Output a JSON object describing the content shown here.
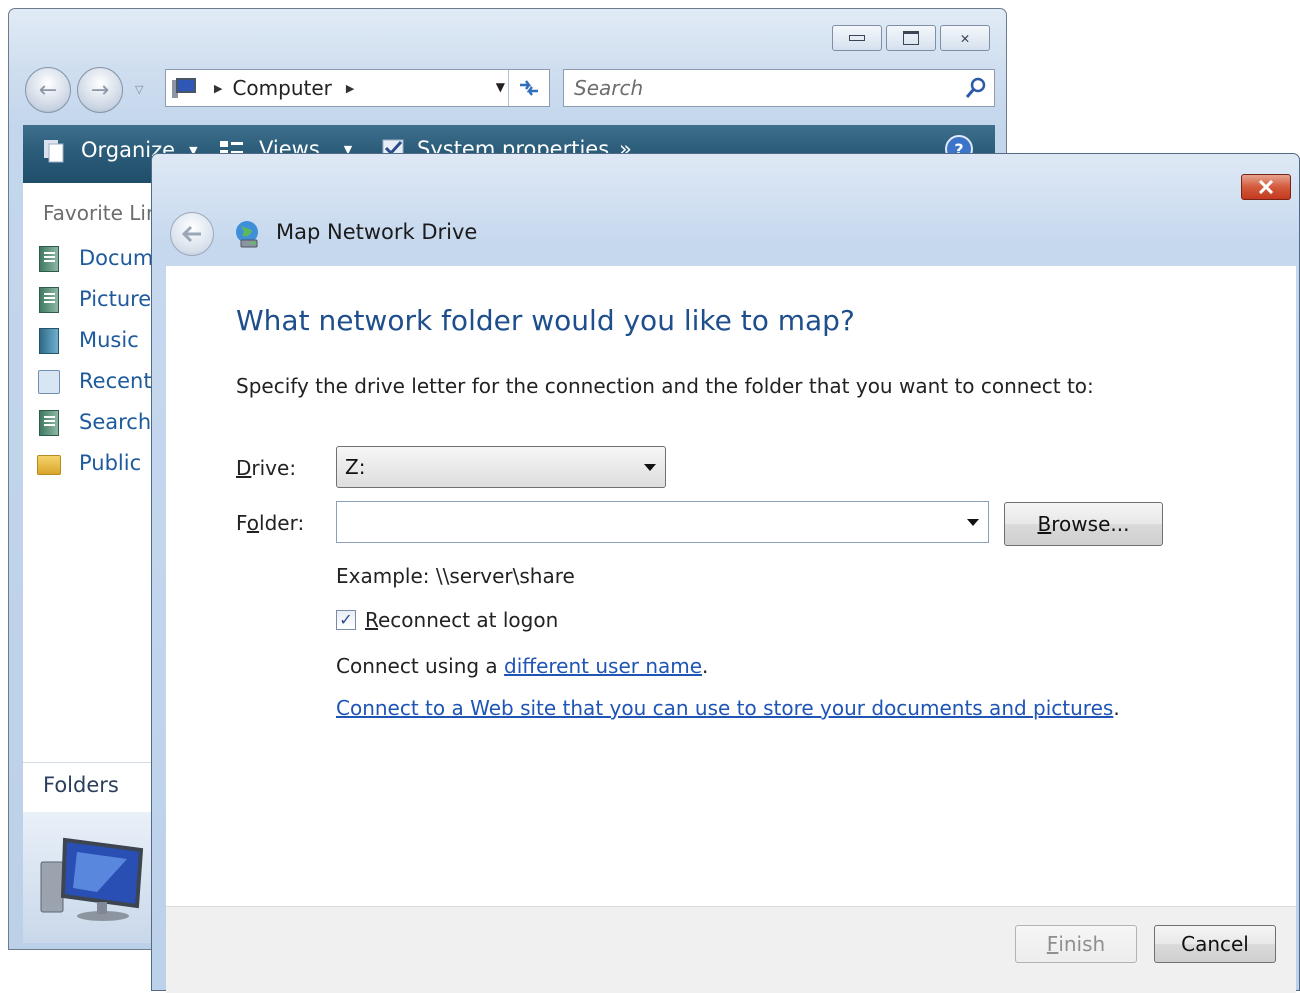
{
  "explorer": {
    "address": {
      "location": "Computer"
    },
    "search": {
      "placeholder": "Search"
    },
    "toolbar": {
      "organize": "Organize",
      "views": "Views",
      "system_properties": "System properties",
      "more": "»"
    },
    "favorites": {
      "title": "Favorite Links",
      "items": [
        {
          "label": "Documents",
          "icon": "documents-icon"
        },
        {
          "label": "Pictures",
          "icon": "pictures-icon"
        },
        {
          "label": "Music",
          "icon": "music-icon"
        },
        {
          "label": "Recently Changed",
          "icon": "recent-icon"
        },
        {
          "label": "Searches",
          "icon": "searches-icon"
        },
        {
          "label": "Public",
          "icon": "public-folder-icon"
        }
      ]
    },
    "folders_label": "Folders"
  },
  "dialog": {
    "title": "Map Network Drive",
    "main_instruction": "What network folder would you like to map?",
    "instruction": "Specify the drive letter for the connection and the folder that you want to connect to:",
    "drive": {
      "label_accel": "D",
      "label_rest": "rive:",
      "value": "Z:"
    },
    "folder": {
      "label_pre": "F",
      "label_accel": "o",
      "label_post": "lder:",
      "value": ""
    },
    "browse": {
      "accel": "B",
      "rest": "rowse..."
    },
    "example": "Example: \\\\server\\share",
    "reconnect": {
      "checked": true,
      "accel": "R",
      "rest": "econnect at logon"
    },
    "connect_prefix": "Connect using a ",
    "connect_link": "different user name",
    "connect_suffix": ".",
    "web_link": "Connect to a Web site that you can use to store your documents and pictures",
    "web_suffix": ".",
    "finish": {
      "accel": "F",
      "rest": "inish"
    },
    "cancel": "Cancel"
  },
  "colors": {
    "link": "#1f55b5",
    "main_instruction": "#1e4f8c",
    "toolbar": "#2b5c79",
    "close_button": "#d45a3d"
  }
}
